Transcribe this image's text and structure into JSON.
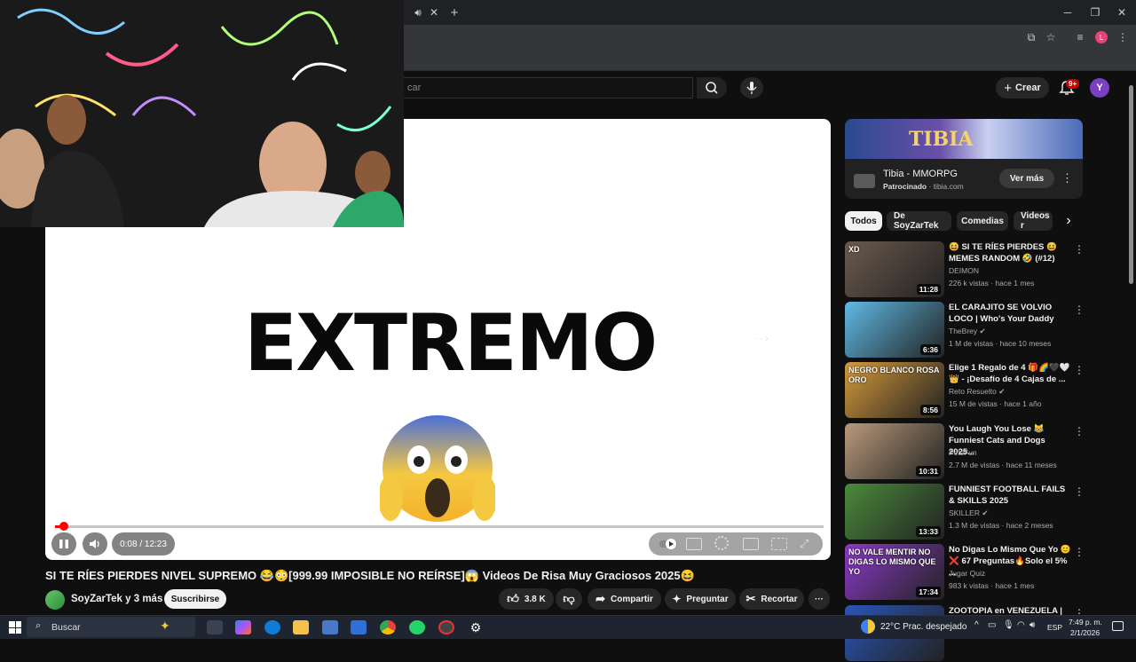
{
  "browser": {
    "new_tab": "+",
    "minimize": "─",
    "restore": "❐",
    "close": "✕",
    "profile_initial": "L"
  },
  "youtube": {
    "search_placeholder": "car",
    "create_label": "Crear",
    "notif_count": "9+",
    "avatar_initial": "Y"
  },
  "player": {
    "overlay_text": "EXTREMO",
    "time": "0:08 / 12:23",
    "progress_fraction": 0.011
  },
  "video": {
    "title": "SI TE RÍES PIERDES NIVEL SUPREMO 😂😳[999.99 IMPOSIBLE NO REÍRSE]😱 Videos De Risa Muy Graciosos 2025😆",
    "channel": "SoyZarTek y 3 más",
    "subscribe": "Suscribirse",
    "likes": "3.8 K",
    "share": "Compartir",
    "ask": "Preguntar",
    "clip": "Recortar"
  },
  "ad": {
    "logo_text": "TIBIA",
    "title": "Tibia - MMORPG",
    "sponsored": "Patrocinado",
    "domain": "tibia.com",
    "cta": "Ver más"
  },
  "chips": [
    "Todos",
    "De SoyZarTek",
    "Comedias",
    "Videos r"
  ],
  "recommendations": [
    {
      "title": "😆 SI TE RÍES PIERDES 😆 MEMES RANDOM 🤣 (#12)",
      "channel": "DEIMON",
      "meta": "226 k vistas · hace 1 mes",
      "duration": "11:28",
      "thumb_color": "#6b5a4e",
      "thumb_text": "XD"
    },
    {
      "title": "EL CARAJITO SE VOLVIO LOCO | Who's Your Daddy",
      "channel": "TheBrey ✔",
      "meta": "1 M de vistas · hace 10 meses",
      "duration": "6:36",
      "thumb_color": "#5fb9e6",
      "thumb_text": ""
    },
    {
      "title": "Elige 1 Regalo de 4 🎁🌈🖤🤍👑 - ¡Desafío de 4 Cajas de ...",
      "channel": "Reto Resuelto ✔",
      "meta": "15 M de vistas · hace 1 año",
      "duration": "8:56",
      "thumb_color": "#d49a3a",
      "thumb_text": "NEGRO BLANCO ROSA ORO"
    },
    {
      "title": "You Laugh You Lose 😹 Funniest Cats and Dogs 2025...",
      "channel": "PetsFun",
      "meta": "2.7 M de vistas · hace 11 meses",
      "duration": "10:31",
      "thumb_color": "#b89a7a",
      "thumb_text": ""
    },
    {
      "title": "FUNNIEST FOOTBALL FAILS & SKILLS 2025",
      "channel": "SKILLER ✔",
      "meta": "1.3 M de vistas · hace 2 meses",
      "duration": "13:33",
      "thumb_color": "#4a8a3a",
      "thumb_text": ""
    },
    {
      "title": "No Digas Lo Mismo Que Yo 😊 ❌ 67 Preguntas🔥Solo el 5% ...",
      "channel": "Jugar Quiz",
      "meta": "983 k vistas · hace 1 mes",
      "duration": "17:34",
      "thumb_color": "#8a3ac8",
      "thumb_text": "NO VALE MENTIR NO DIGAS LO MISMO QUE YO"
    },
    {
      "title": "ZOOTOPIA en VENEZUELA |",
      "channel": "",
      "meta": "",
      "duration": "",
      "thumb_color": "#2a55b8",
      "thumb_text": ""
    }
  ],
  "taskbar": {
    "search_label": "Buscar",
    "weather": "22°C  Prac. despejado",
    "lang": "ESP",
    "time": "7:49 p. m.",
    "date": "2/1/2026"
  }
}
